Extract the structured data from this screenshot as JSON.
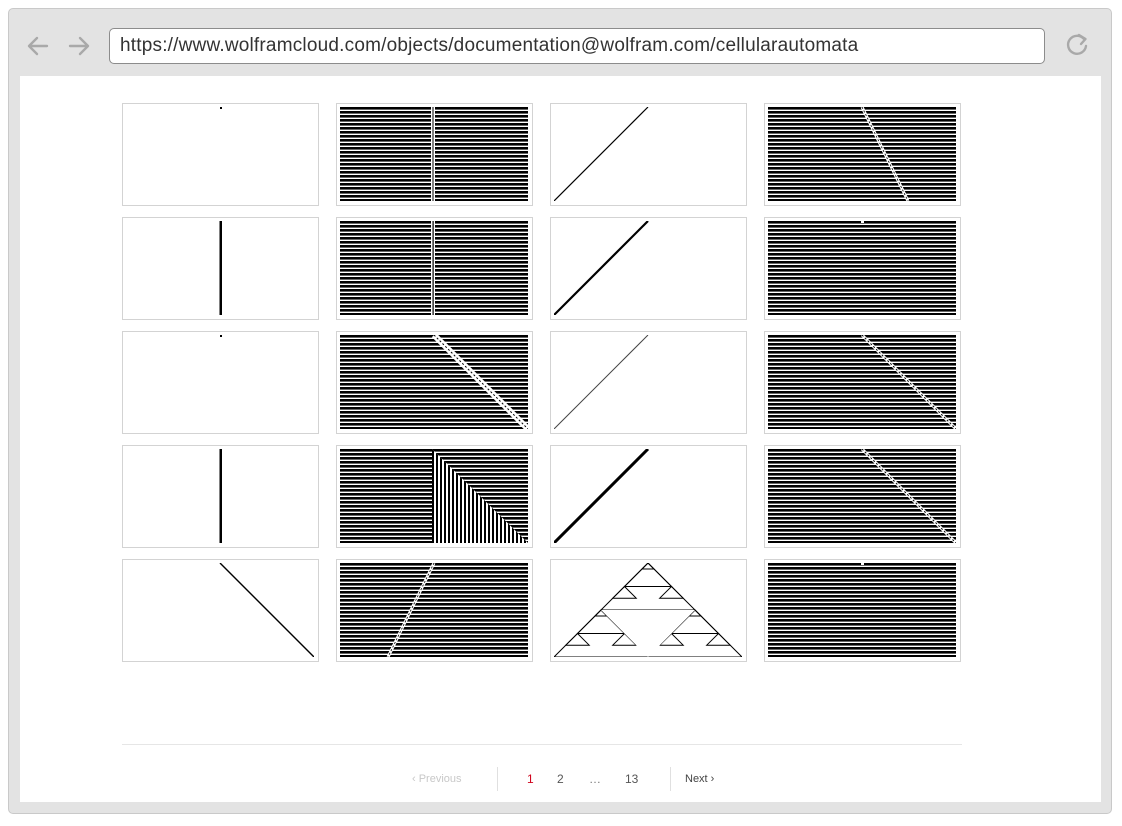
{
  "browser": {
    "url": "https://www.wolframcloud.com/objects/documentation@wolfram.com/cellularautomata",
    "back_icon": "back-arrow-icon",
    "forward_icon": "forward-arrow-icon",
    "reload_icon": "reload-icon"
  },
  "gallery": {
    "rows": 5,
    "columns": 4,
    "tile_count": 20
  },
  "pagination": {
    "previous_label": "‹ Previous",
    "pages": [
      "1",
      "2",
      "…",
      "13"
    ],
    "current_page": "1",
    "next_label": "Next ›"
  },
  "colors": {
    "current_page": "#d0021b",
    "disabled": "#c8c8c8"
  }
}
